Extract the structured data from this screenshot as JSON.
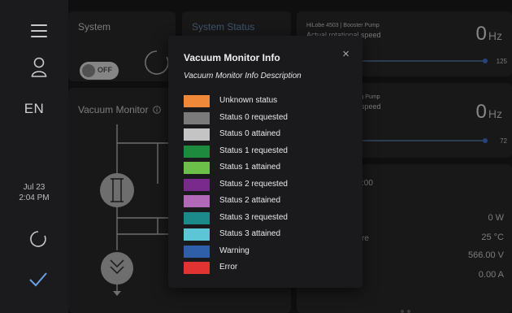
{
  "rail": {
    "language": "EN",
    "date": "Jul 23",
    "time": "2:04 PM"
  },
  "system": {
    "title": "System",
    "toggle_label": "OFF"
  },
  "system_status": {
    "title": "System Status"
  },
  "vacuum_monitor": {
    "title": "Vacuum Monitor"
  },
  "pumps": [
    {
      "name": "HiLobe 4503 | Booster Pump",
      "subtitle": "Actual rotational speed",
      "value": "0",
      "unit": "Hz",
      "max": "125"
    },
    {
      "name": "HiLobe 4503 | Backing Pump",
      "subtitle": "Actual rotational speed",
      "value": "0",
      "unit": "Hz",
      "max": "72"
    }
  ],
  "readings": {
    "top_value": ":00",
    "temp_label_fragment": "re",
    "power": "0 W",
    "temperature": "25 °C",
    "voltage": "566.00 V",
    "current": "0.00 A"
  },
  "modal": {
    "title": "Vacuum Monitor Info",
    "description": "Vacuum Monitor Info Description",
    "close_glyph": "×",
    "legend": [
      {
        "color": "#f0883a",
        "label": "Unknown status"
      },
      {
        "color": "#7a7a7a",
        "label": "Status 0 requested"
      },
      {
        "color": "#c4c4c4",
        "label": "Status 0 attained"
      },
      {
        "color": "#1e8a3e",
        "label": "Status 1 requested"
      },
      {
        "color": "#6cc04a",
        "label": "Status 1 attained"
      },
      {
        "color": "#7a2a8c",
        "label": "Status 2 requested"
      },
      {
        "color": "#b269b8",
        "label": "Status 2 attained"
      },
      {
        "color": "#1c8a8a",
        "label": "Status 3 requested"
      },
      {
        "color": "#5cc6d6",
        "label": "Status 3 attained"
      },
      {
        "color": "#2f5fa8",
        "label": "Warning"
      },
      {
        "color": "#e23333",
        "label": "Error"
      }
    ]
  }
}
